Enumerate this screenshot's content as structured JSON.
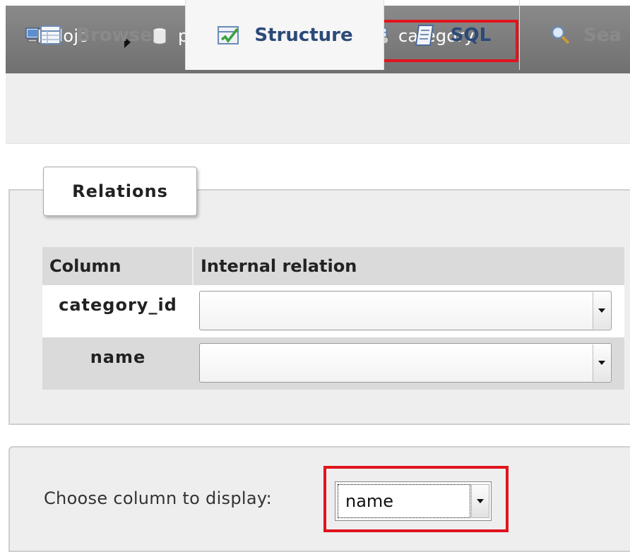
{
  "breadcrumb": {
    "server": "dojo",
    "database": "pma-relations",
    "table": "category"
  },
  "tabs": [
    {
      "label": "Browse"
    },
    {
      "label": "Structure"
    },
    {
      "label": "SQL"
    },
    {
      "label": "Sea"
    }
  ],
  "relations": {
    "legend": "Relations",
    "headers": {
      "column": "Column",
      "internal_relation": "Internal relation"
    },
    "rows": [
      {
        "column": "category_id",
        "value": ""
      },
      {
        "column": "name",
        "value": ""
      }
    ]
  },
  "display": {
    "label": "Choose column to display:",
    "value": "name"
  },
  "colors": {
    "highlight": "#e0141d",
    "breadcrumb_bg": "#7a7a7a",
    "header_bg": "#dadada",
    "panel_bg": "#eeeeee"
  }
}
